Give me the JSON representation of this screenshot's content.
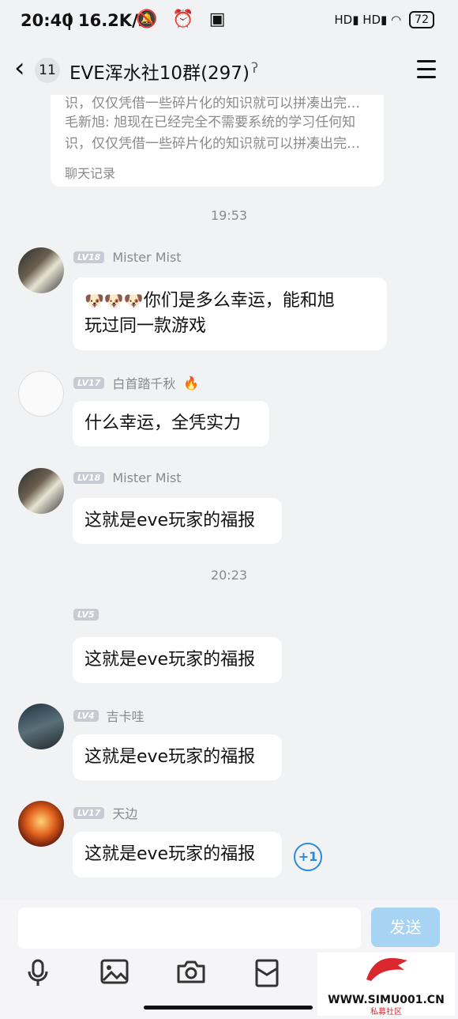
{
  "status_bar": {
    "time": "20:40",
    "speed": "| 16.2K/s",
    "icons": "🔕 ⏰ ▣",
    "signal": "HD▮ HD▮ ◠",
    "battery": "72"
  },
  "header": {
    "back_icon": "‹",
    "unread_count": "11",
    "title": "EVE浑水社10群(297)",
    "ear_icon": "ʔ"
  },
  "quoted_card": {
    "lines": [
      "识，仅仅凭借一些碎片化的知识就可以拼凑出完…",
      "毛新旭: 旭现在已经完全不需要系统的学习任何知",
      "识，仅仅凭借一些碎片化的知识就可以拼凑出完…"
    ],
    "footer": "聊天记录"
  },
  "messages": {
    "ts1": "19:53",
    "m1": {
      "level": "LV18",
      "name": "Mister Mist",
      "emoji": "🐶🐶🐶",
      "text_line1": "你们是多么幸运，能和旭",
      "text_line2": "玩过同一款游戏"
    },
    "m2": {
      "level": "LV17",
      "name": "白首踏千秋",
      "badge": "🔥",
      "text": "什么幸运，全凭实力"
    },
    "m3": {
      "level": "LV18",
      "name": "Mister Mist",
      "text": "这就是eve玩家的福报"
    },
    "ts2": "20:23",
    "m4": {
      "level": "LV5",
      "name": "",
      "text": "这就是eve玩家的福报"
    },
    "m5": {
      "level": "LV4",
      "name": "吉卡哇",
      "text": "这就是eve玩家的福报"
    },
    "m6": {
      "level": "LV17",
      "name": "天边",
      "text": "这就是eve玩家的福报",
      "plus_one": "+1"
    }
  },
  "input_bar": {
    "send_label": "发送",
    "tools": [
      "mic-icon",
      "image-icon",
      "camera-icon",
      "redpacket-icon"
    ]
  },
  "watermark": {
    "url": "WWW.SIMU001.CN",
    "sub": "私募社区"
  },
  "colors": {
    "background": "#f1f2f4",
    "send_button": "#a7d4f2",
    "accent_blue": "#2b8ad8",
    "level_badge": "#c7cbd3"
  }
}
